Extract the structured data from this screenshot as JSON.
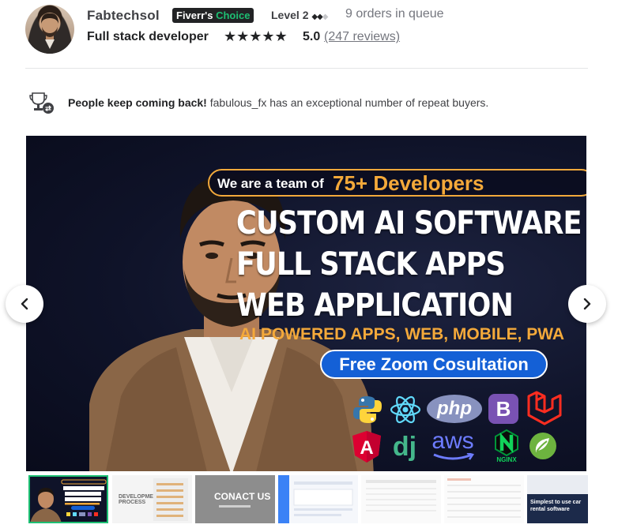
{
  "seller": {
    "name": "Fabtechsol",
    "badge_prefix": "Fiverr's",
    "badge_word": "Choice",
    "level_label": "Level 2",
    "queue": "9 orders in queue",
    "title": "Full stack developer",
    "stars": "★★★★★",
    "rating": "5.0",
    "reviews": "(247 reviews)"
  },
  "repeat": {
    "bold": "People keep coming back!",
    "text": " fabulous_fx has an exceptional number of repeat buyers."
  },
  "hero": {
    "team_small": "We are a team of",
    "team_big": "75+ Developers",
    "line1": "CUSTOM AI SOFTWARE",
    "line2": "FULL STACK APPS",
    "line3": "WEB APPLICATION",
    "sub": "AI POWERED APPS, WEB, MOBILE, PWA",
    "cta": "Free Zoom Cosultation",
    "tech": [
      "python",
      "react",
      "php",
      "bootstrap",
      "laravel",
      "angular",
      "django",
      "aws",
      "nginx",
      "spring"
    ],
    "tech_labels": {
      "php": "php",
      "bootstrap": "B",
      "angular": "A",
      "django": "dj",
      "aws": "aws",
      "nginx": "NGINX"
    }
  },
  "thumbnails": [
    {
      "label": "",
      "active": true
    },
    {
      "label": "DEVELOPMENT PROCESS",
      "active": false
    },
    {
      "label": "CONACT US",
      "active": false
    },
    {
      "label": "",
      "active": false
    },
    {
      "label": "",
      "active": false
    },
    {
      "label": "",
      "active": false
    },
    {
      "label": "Simplest to use car rental software",
      "active": false
    }
  ],
  "colors": {
    "brand_green": "#1dbf73",
    "accent_orange": "#f4a93a",
    "cta_blue": "#1460d6",
    "hero_bg": "#0f1329"
  }
}
